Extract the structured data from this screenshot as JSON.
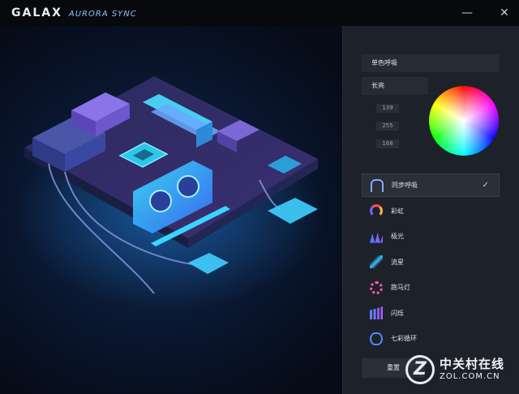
{
  "window": {
    "brand": "GALAX",
    "product": "AURORA SYNC",
    "minimize_glyph": "—",
    "close_glyph": "✕"
  },
  "panel": {
    "mode_label": "单色呼吸",
    "duration_label": "长亮",
    "rgb": {
      "r": "139",
      "g": "255",
      "b": "168"
    },
    "effects": [
      {
        "label": "同步呼吸",
        "icon": "sync-breathe-icon",
        "active": true
      },
      {
        "label": "彩虹",
        "icon": "rainbow-icon",
        "active": false
      },
      {
        "label": "极光",
        "icon": "aurora-icon",
        "active": false
      },
      {
        "label": "流星",
        "icon": "meteor-icon",
        "active": false
      },
      {
        "label": "跑马灯",
        "icon": "marquee-icon",
        "active": false
      },
      {
        "label": "闪烁",
        "icon": "flash-icon",
        "active": false
      },
      {
        "label": "七彩循环",
        "icon": "color-cycle-icon",
        "active": false
      }
    ],
    "check_glyph": "✓",
    "reset_label": "重置"
  },
  "watermark": {
    "logo_letter": "Z",
    "cn": "中关村在线",
    "en": "ZOL.COM.CN"
  },
  "colors": {
    "accent_glow": "#2fd3ff",
    "board_purple": "#3a2f6b",
    "panel_bg": "#1d2129"
  }
}
